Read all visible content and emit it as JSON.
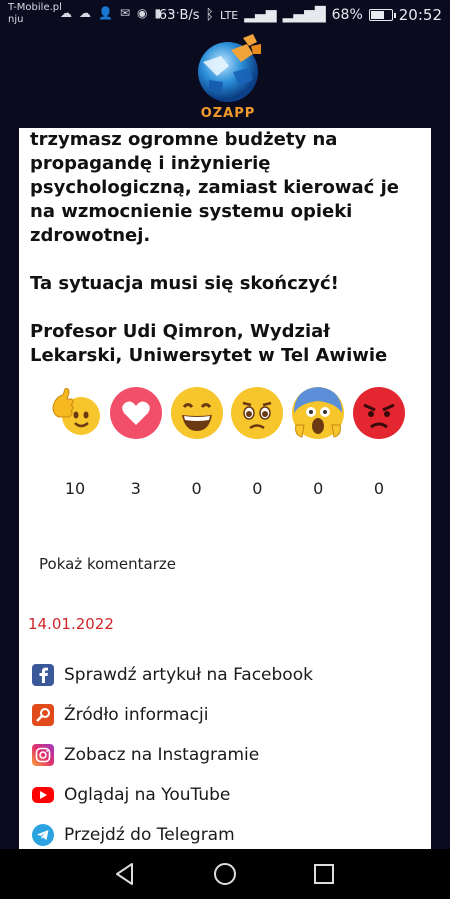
{
  "status_bar": {
    "carrier_line1": "T-Mobile.pl",
    "carrier_line2": "nju",
    "net_speed": "63 B/s",
    "network_type": "LTE",
    "battery_percent": "68%",
    "battery_level": 0.68,
    "time": "20:52",
    "icons_left": [
      "cloud-icon",
      "cloud-icon",
      "add-person-icon",
      "mail-icon",
      "messenger-icon",
      "bag-icon",
      "more-icon"
    ]
  },
  "logo": {
    "text": "OZAPP"
  },
  "article": {
    "paragraph1": "trzymasz ogromne budżety na propagandę i inżynierię psychologiczną, zamiast kierować je na wzmocnienie systemu opieki zdrowotnej.",
    "paragraph2": "Ta sytuacja musi się skończyć!",
    "paragraph3": "Profesor Udi Qimron, Wydział Lekarski, Uniwersytet w Tel Awiwie"
  },
  "reactions": [
    {
      "name": "thumbs-up",
      "count": "10"
    },
    {
      "name": "heart",
      "count": "3"
    },
    {
      "name": "laugh",
      "count": "0"
    },
    {
      "name": "sad",
      "count": "0"
    },
    {
      "name": "shock",
      "count": "0"
    },
    {
      "name": "angry",
      "count": "0"
    }
  ],
  "comments": {
    "show_label": "Pokaż komentarze"
  },
  "date": "14.01.2022",
  "links": [
    {
      "label": "Sprawdź artykuł na Facebook",
      "icon": "facebook-icon",
      "color": "#3b5998"
    },
    {
      "label": "Źródło informacji",
      "icon": "search-icon",
      "color": "#e14b1c"
    },
    {
      "label": "Zobacz na Instagramie",
      "icon": "instagram-icon",
      "color": "#e1306c"
    },
    {
      "label": "Oglądaj na YouTube",
      "icon": "youtube-icon",
      "color": "#ff0000"
    },
    {
      "label": "Przejdź do Telegram",
      "icon": "telegram-icon",
      "color": "#2aa3e0"
    }
  ]
}
